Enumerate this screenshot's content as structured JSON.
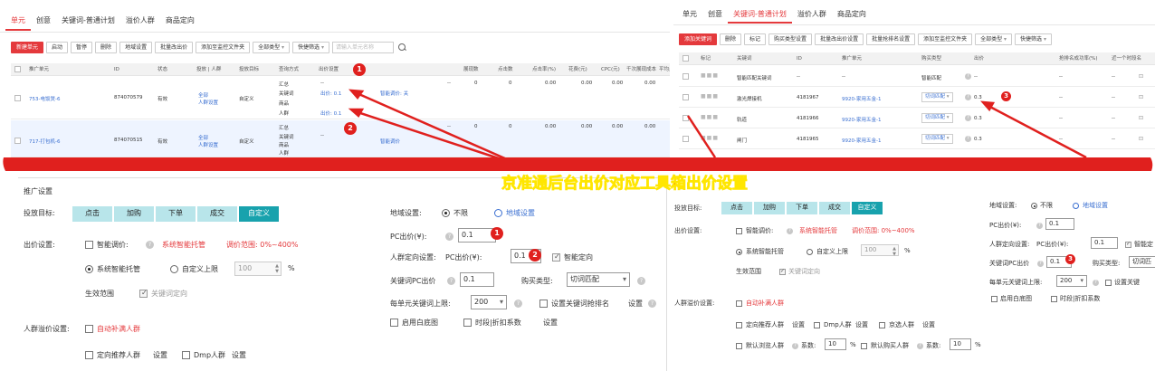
{
  "colors": {
    "accent": "#e4393c",
    "teal": "#18a2ad",
    "teal_light": "#b8e5ea",
    "link": "#3a6fd1",
    "banner_red": "#e0201e",
    "banner_text": "#ffe600"
  },
  "banner": {
    "title": "京准通后台出价对应工具箱出价设置"
  },
  "left_top": {
    "tabs": [
      "单元",
      "创意",
      "关键词-普通计划",
      "溢价人群",
      "商品定向"
    ],
    "toolbar": {
      "new_unit": "新建单元",
      "start": "启动",
      "pause": "暂停",
      "delete": "删除",
      "region": "地域设置",
      "batch_bid": "批量改出价",
      "add_folder": "添加至监控文件夹",
      "all_types": "全部类型",
      "quick_filter": "快捷筛选",
      "search_placeholder": "请输入单元名称"
    },
    "headers": [
      "推广单元",
      "ID",
      "状态",
      "投放 | 人群",
      "投放目标",
      "查询方式",
      "出价设置",
      "展现数",
      "点击数",
      "点击率(%)",
      "花费(元)",
      "CPC(元)",
      "千次展现成本",
      "平均点"
    ],
    "rows": [
      {
        "name": "753-电饭煲-6",
        "id": "874070579",
        "status": "有效",
        "crowd1": "全部",
        "crowd2": "人群设置",
        "target": "自定义",
        "modes": [
          "汇总",
          "关键词",
          "商品",
          "人群"
        ],
        "bid_dash": "--",
        "pc_bid": "出价: 0.1",
        "pc_bid2": "出价: 0.1",
        "smart": "智能调价: 关",
        "v1": "--",
        "v2": "0",
        "v3": "0",
        "v4": "0.00",
        "v5": "0.00",
        "v6": "0.00",
        "v7": "0.00"
      },
      {
        "name": "717-打包机-6",
        "id": "874070515",
        "status": "有效",
        "crowd1": "全部",
        "crowd2": "人群设置",
        "target": "自定义",
        "modes": [
          "汇总",
          "关键词",
          "商品",
          "人群"
        ],
        "bid_dash": "--",
        "pc_bid": "--",
        "pc_bid2": "",
        "smart": "智能调价",
        "v1": "--",
        "v2": "0",
        "v3": "0",
        "v4": "0.00",
        "v5": "0.00",
        "v6": "0.00",
        "v7": "0.00"
      }
    ]
  },
  "right_top": {
    "tabs": [
      "单元",
      "创意",
      "关键词-普通计划",
      "溢价人群",
      "商品定向"
    ],
    "toolbar": {
      "add_keyword": "添加关键词",
      "delete": "删除",
      "tag": "标记",
      "match_type": "购买类型设置",
      "batch_bid": "批量改出价设置",
      "batch_rank": "批量抢排名设置",
      "add_folder": "添加至监控文件夹",
      "all_types": "全部类型",
      "quick_filter": "快捷筛选"
    },
    "headers": [
      "标记",
      "关键词",
      "ID",
      "推广单元",
      "购买类型",
      "出价",
      "抢排名成功率(%)",
      "近一个时段名"
    ],
    "rows": [
      {
        "keyword": "智能匹配关键词",
        "id": "--",
        "unit": "--",
        "match": "智能匹配",
        "bid": "--",
        "rate": "--",
        "last": "--"
      },
      {
        "keyword": "激光焊接机",
        "id": "4181967",
        "unit": "9920-家用五金-1",
        "match": "切词匹配",
        "bid": "0.3",
        "rate": "--",
        "last": "--"
      },
      {
        "keyword": "轨道",
        "id": "4181966",
        "unit": "9920-家用五金-1",
        "match": "切词匹配",
        "bid": "0.3",
        "rate": "--",
        "last": "--"
      },
      {
        "keyword": "闸门",
        "id": "4181965",
        "unit": "9920-家用五金-1",
        "match": "切词匹配",
        "bid": "0.3",
        "rate": "--",
        "last": "--"
      }
    ]
  },
  "left_form": {
    "section": "推广设置",
    "target_label": "投放目标:",
    "targets": [
      "点击",
      "加购",
      "下单",
      "成交",
      "自定义"
    ],
    "bid_label": "出价设置:",
    "smart_bid": "智能调价:",
    "smart_host": "系统智能托管",
    "range": "调价范围: 0%~400%",
    "sys_host": "系统智能托管",
    "custom_cap": "自定义上限",
    "cap_value": "100",
    "percent": "%",
    "scope_label": "生效范围",
    "scope_kw": "关键词定向",
    "region_label": "地域设置:",
    "unlimited": "不限",
    "region_set": "地域设置",
    "pc_bid_label": "PC出价(¥):",
    "pc_bid_value": "0.1",
    "crowd_label": "人群定向设置:",
    "crowd_pc": "PC出价(¥):",
    "crowd_value": "0.1",
    "smart_target": "智能定向",
    "kw_pc_label": "关键词PC出价",
    "kw_pc_value": "0.1",
    "buy_type_label": "购买类型:",
    "buy_type_value": "切词匹配",
    "max_kw_label": "每单元关键词上限:",
    "max_kw_value": "200",
    "rank_label": "设置关键词抢排名",
    "rank_set": "设置",
    "baseline": "启用白底图",
    "time_discount": "时段|折扣系数",
    "time_set": "设置",
    "premium_label": "人群溢价设置:",
    "auto_fill": "自动补满人群",
    "recommend": "定向推荐人群",
    "set1": "设置",
    "dmp": "Dmp人群",
    "set2": "设置"
  },
  "right_form": {
    "target_label": "投放目标:",
    "targets": [
      "点击",
      "加购",
      "下单",
      "成交",
      "自定义"
    ],
    "bid_label": "出价设置:",
    "smart_bid": "智能调价:",
    "smart_host": "系统智能托管",
    "range": "调价范围: 0%~400%",
    "sys_host": "系统智能托管",
    "custom_cap": "自定义上限",
    "cap_value": "100",
    "percent": "%",
    "scope_label": "生效范围",
    "scope_kw": "关键词定向",
    "region_label": "地域设置:",
    "unlimited": "不限",
    "region_set": "地域设置",
    "pc_bid_label": "PC出价(¥):",
    "pc_bid_value": "0.1",
    "crowd_label": "人群定向设置:",
    "crowd_pc": "PC出价(¥):",
    "crowd_value": "0.1",
    "smart_target": "智能定",
    "kw_pc_label": "关键词PC出价",
    "kw_pc_value": "0.1",
    "buy_type_label": "购买类型:",
    "buy_type_value": "切词匹",
    "max_kw_label": "每单元关键词上限:",
    "max_kw_value": "200",
    "rank_label": "设置关键",
    "baseline": "启用白底图",
    "time_discount": "时段|折扣系数",
    "premium_label": "人群溢价设置:",
    "auto_fill": "自动补满人群",
    "recommend": "定向推荐人群",
    "set1": "设置",
    "dmp": "Dmp人群",
    "set2": "设置",
    "jd_crowd": "京选人群",
    "set3": "设置",
    "browse": "默认浏览人群",
    "coef1": "系数:",
    "coef1_value": "10",
    "pct1": "%",
    "buy": "默认购买人群",
    "coef2": "系数:",
    "coef2_value": "10",
    "pct2": "%"
  }
}
